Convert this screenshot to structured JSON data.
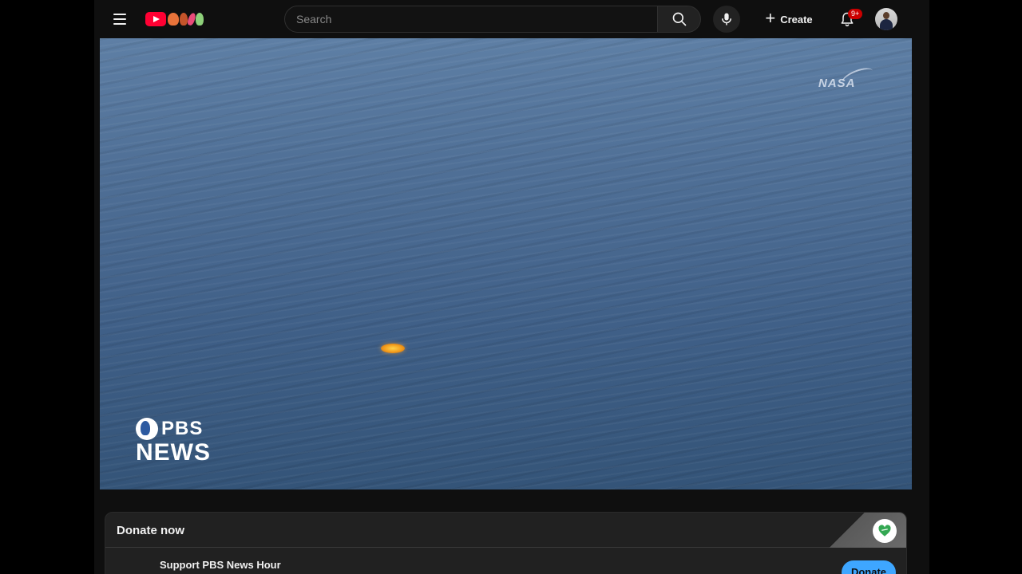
{
  "masthead": {
    "search_placeholder": "Search",
    "create_label": "Create",
    "notifications_badge": "9+",
    "brand_color": "#ff0033"
  },
  "video": {
    "watermark_top_right": "NASA",
    "watermark_bottom_left_line1": "PBS",
    "watermark_bottom_left_line2": "NEWS"
  },
  "donate_shelf": {
    "title": "Donate now",
    "support_text": "Support PBS News Hour",
    "button_label": "Donate",
    "button_color": "#3ea6ff"
  },
  "icons": {
    "menu": "hamburger-icon",
    "search": "search-icon",
    "mic": "microphone-icon",
    "create": "plus-icon",
    "notifications": "bell-icon",
    "donate": "heart-icon"
  }
}
